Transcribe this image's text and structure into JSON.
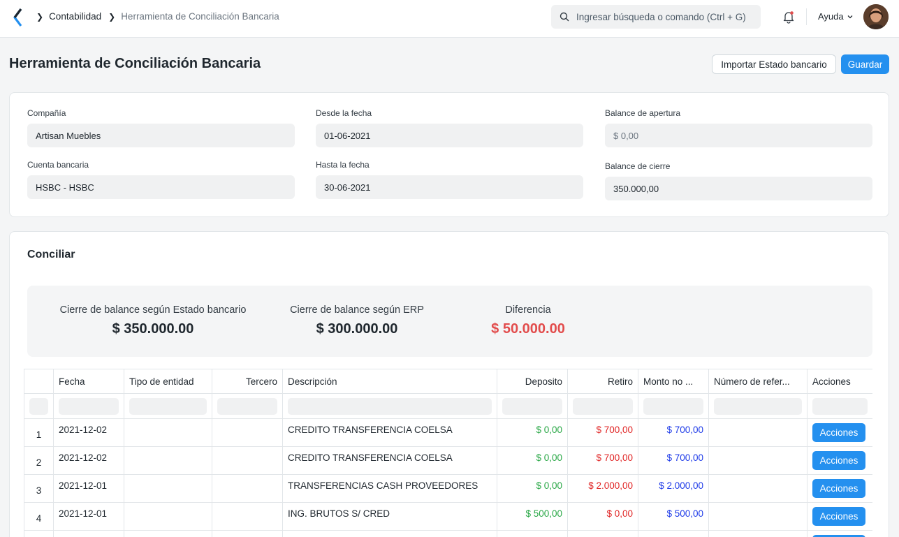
{
  "navbar": {
    "breadcrumbs": [
      "Contabilidad",
      "Herramienta de Conciliación Bancaria"
    ],
    "search_placeholder": "Ingresar búsqueda o comando (Ctrl + G)",
    "help_label": "Ayuda"
  },
  "page": {
    "title": "Herramienta de Conciliación Bancaria",
    "import_label": "Importar Estado bancario",
    "save_label": "Guardar"
  },
  "form": {
    "company_label": "Compañía",
    "company_value": "Artisan Muebles",
    "bank_account_label": "Cuenta bancaria",
    "bank_account_value": "HSBC - HSBC",
    "from_date_label": "Desde la fecha",
    "from_date_value": "01-06-2021",
    "to_date_label": "Hasta la fecha",
    "to_date_value": "30-06-2021",
    "opening_balance_label": "Balance de apertura",
    "opening_balance_value": "$ 0,00",
    "closing_balance_label": "Balance de cierre",
    "closing_balance_value": "350.000,00"
  },
  "reconcile": {
    "title": "Conciliar",
    "summary": [
      {
        "label": "Cierre de balance según Estado bancario",
        "value": "$ 350.000.00"
      },
      {
        "label": "Cierre de balance según ERP",
        "value": "$ 300.000.00"
      },
      {
        "label": "Diferencia",
        "value": "$ 50.000.00"
      }
    ],
    "columns": [
      "Fecha",
      "Tipo de entidad",
      "Tercero",
      "Descripción",
      "Deposito",
      "Retiro",
      "Monto no ...",
      "Número de refer...",
      "Acciones"
    ],
    "rows": [
      {
        "n": "1",
        "date": "2021-12-02",
        "desc": "CREDITO TRANSFERENCIA COELSA",
        "deposit": "$ 0,00",
        "withdrawal": "$ 700,00",
        "unallocated": "$ 700,00",
        "action": "Acciones"
      },
      {
        "n": "2",
        "date": "2021-12-02",
        "desc": "CREDITO TRANSFERENCIA COELSA",
        "deposit": "$ 0,00",
        "withdrawal": "$ 700,00",
        "unallocated": "$ 700,00",
        "action": "Acciones"
      },
      {
        "n": "3",
        "date": "2021-12-01",
        "desc": "TRANSFERENCIAS CASH PROVEEDORES",
        "deposit": "$ 0,00",
        "withdrawal": "$ 2.000,00",
        "unallocated": "$ 2.000,00",
        "action": "Acciones"
      },
      {
        "n": "4",
        "date": "2021-12-01",
        "desc": "ING. BRUTOS S/ CRED",
        "deposit": "$ 500,00",
        "withdrawal": "$ 0,00",
        "unallocated": "$ 500,00",
        "action": "Acciones"
      }
    ]
  },
  "colors": {
    "primary": "#2490ef",
    "deposit": "#28a745",
    "withdrawal": "#e02424",
    "unallocated": "#1c39e8",
    "difference": "#e24c4c"
  },
  "icons": [
    "app-logo-icon",
    "chevron-right-icon",
    "search-icon",
    "bell-icon",
    "chevron-down-icon"
  ]
}
